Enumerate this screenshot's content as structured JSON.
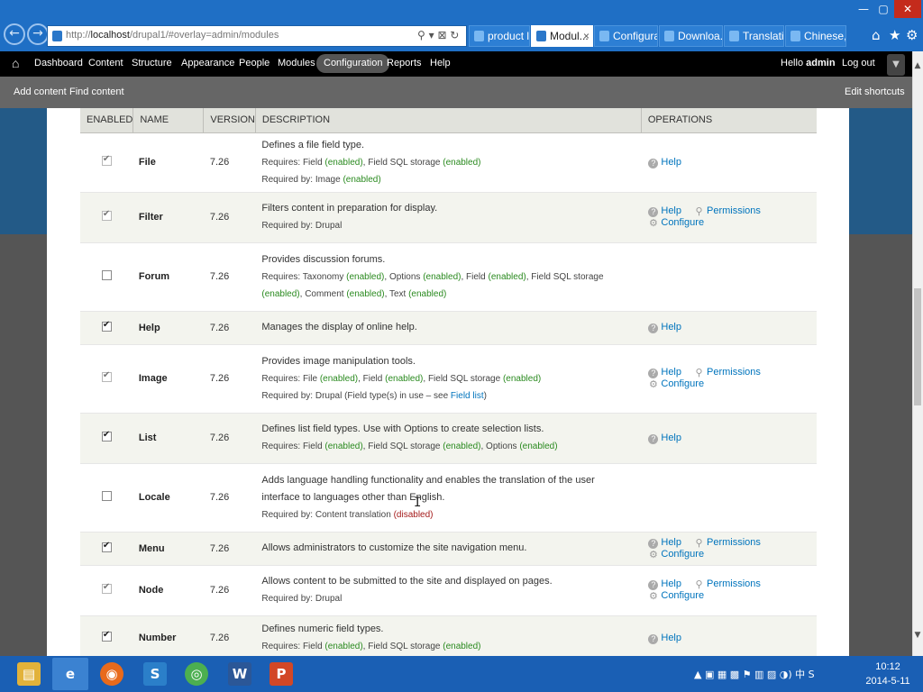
{
  "browser": {
    "url_prefix": "http://",
    "url_host": "localhost",
    "url_rest": "/drupal1/#overlay=admin/modules",
    "address_controls": "⚲ ▾ ⊠ ↻",
    "tabs": [
      "product li...",
      "Modul...",
      "Configura...",
      "Downloa...",
      "Translatio...",
      "Chinese, ..."
    ],
    "tab_close": "×",
    "window_buttons": [
      "—",
      "▢",
      "✕"
    ],
    "toolbar_icons": [
      "⌂",
      "★",
      "⚙"
    ]
  },
  "toolbar": {
    "home_icon": "⌂",
    "items": [
      "Dashboard",
      "Content",
      "Structure",
      "Appearance",
      "People",
      "Modules",
      "Configuration",
      "Reports",
      "Help"
    ],
    "hello": "Hello",
    "user": "admin",
    "logout": "Log out",
    "toggle_icon": "▼"
  },
  "shortcuts": {
    "items": [
      "Add content",
      "Find content"
    ],
    "edit": "Edit shortcuts"
  },
  "table": {
    "headers": [
      "ENABLED",
      "NAME",
      "VERSION",
      "DESCRIPTION",
      "OPERATIONS"
    ],
    "rows": [
      {
        "name": "File",
        "version": "7.26",
        "checked": true,
        "locked": true,
        "desc": "Defines a file field type.",
        "sub": [
          [
            [
              "Requires: Field ",
              ""
            ],
            [
              "(enabled)",
              "en"
            ],
            [
              ", Field SQL storage ",
              ""
            ],
            [
              "(enabled)",
              "en"
            ]
          ],
          [
            [
              "Required by: Image ",
              ""
            ],
            [
              "(enabled)",
              "en"
            ]
          ]
        ],
        "ops": [
          "Help"
        ]
      },
      {
        "name": "Filter",
        "version": "7.26",
        "checked": true,
        "locked": true,
        "desc": "Filters content in preparation for display.",
        "sub": [
          [
            [
              "Required by: Drupal",
              ""
            ]
          ]
        ],
        "ops": [
          "Help",
          "Permissions",
          "Configure"
        ]
      },
      {
        "name": "Forum",
        "version": "7.26",
        "checked": false,
        "locked": false,
        "desc": "Provides discussion forums.",
        "sub": [
          [
            [
              "Requires: Taxonomy ",
              ""
            ],
            [
              "(enabled)",
              "en"
            ],
            [
              ", Options ",
              ""
            ],
            [
              "(enabled)",
              "en"
            ],
            [
              ", Field ",
              ""
            ],
            [
              "(enabled)",
              "en"
            ],
            [
              ", Field SQL storage ",
              ""
            ],
            [
              "(enabled)",
              "en"
            ],
            [
              ", Comment ",
              ""
            ],
            [
              "(enabled)",
              "en"
            ],
            [
              ", Text ",
              ""
            ],
            [
              "(enabled)",
              "en"
            ]
          ]
        ],
        "ops": []
      },
      {
        "name": "Help",
        "version": "7.26",
        "checked": true,
        "locked": false,
        "desc": "Manages the display of online help.",
        "sub": [],
        "ops": [
          "Help"
        ]
      },
      {
        "name": "Image",
        "version": "7.26",
        "checked": true,
        "locked": true,
        "desc": "Provides image manipulation tools.",
        "sub": [
          [
            [
              "Requires: File ",
              ""
            ],
            [
              "(enabled)",
              "en"
            ],
            [
              ", Field ",
              ""
            ],
            [
              "(enabled)",
              "en"
            ],
            [
              ", Field SQL storage ",
              ""
            ],
            [
              "(enabled)",
              "en"
            ]
          ],
          [
            [
              "Required by: Drupal (Field type(s) in use – see ",
              ""
            ],
            [
              "Field list",
              "lnk"
            ],
            [
              ")",
              ""
            ]
          ]
        ],
        "ops": [
          "Help",
          "Permissions",
          "Configure"
        ]
      },
      {
        "name": "List",
        "version": "7.26",
        "checked": true,
        "locked": false,
        "desc": "Defines list field types. Use with Options to create selection lists.",
        "sub": [
          [
            [
              "Requires: Field ",
              ""
            ],
            [
              "(enabled)",
              "en"
            ],
            [
              ", Field SQL storage ",
              ""
            ],
            [
              "(enabled)",
              "en"
            ],
            [
              ", Options ",
              ""
            ],
            [
              "(enabled)",
              "en"
            ]
          ]
        ],
        "ops": [
          "Help"
        ]
      },
      {
        "name": "Locale",
        "version": "7.26",
        "checked": false,
        "locked": false,
        "desc": "Adds language handling functionality and enables the translation of the user interface to languages other than English.",
        "sub": [
          [
            [
              "Required by: Content translation ",
              ""
            ],
            [
              "(disabled)",
              "dis"
            ]
          ]
        ],
        "ops": []
      },
      {
        "name": "Menu",
        "version": "7.26",
        "checked": true,
        "locked": false,
        "desc": "Allows administrators to customize the site navigation menu.",
        "sub": [],
        "ops": [
          "Help",
          "Permissions",
          "Configure"
        ]
      },
      {
        "name": "Node",
        "version": "7.26",
        "checked": true,
        "locked": true,
        "desc": "Allows content to be submitted to the site and displayed on pages.",
        "sub": [
          [
            [
              "Required by: Drupal",
              ""
            ]
          ]
        ],
        "ops": [
          "Help",
          "Permissions",
          "Configure"
        ]
      },
      {
        "name": "Number",
        "version": "7.26",
        "checked": true,
        "locked": false,
        "desc": "Defines numeric field types.",
        "sub": [
          [
            [
              "Requires: Field ",
              ""
            ],
            [
              "(enabled)",
              "en"
            ],
            [
              ", Field SQL storage ",
              ""
            ],
            [
              "(enabled)",
              "en"
            ]
          ]
        ],
        "ops": [
          "Help"
        ]
      }
    ]
  },
  "op_icons": {
    "Help": "?",
    "Permissions": "⚲",
    "Configure": "⚙"
  },
  "taskbar": {
    "apps": [
      "▤",
      "e",
      "◉",
      "S",
      "◎",
      "W",
      "P"
    ],
    "tray": "▲ ▣ ▦ ▩ ⚑ ▥ ▨ ◑) 中 S",
    "time": "10:12",
    "date": "2014-5-11"
  },
  "cursor": "I"
}
